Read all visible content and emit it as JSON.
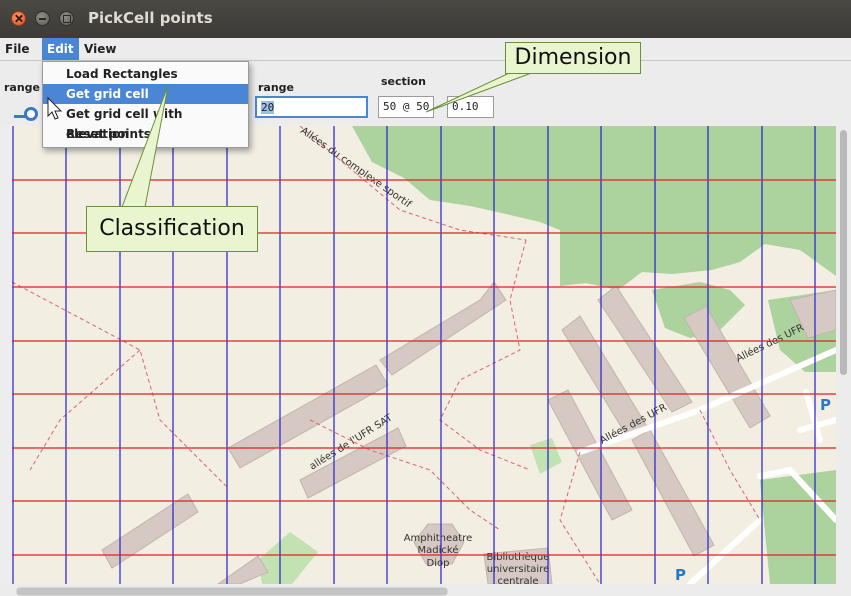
{
  "window": {
    "title": "PickCell points"
  },
  "menubar": {
    "file": "File",
    "edit": "Edit",
    "view": "View"
  },
  "edit_menu": {
    "items": [
      "Load Rectangles",
      "Get grid cell",
      "Get grid cell with elevation",
      "Reset points"
    ],
    "highlighted_index": 1
  },
  "toolbar": {
    "range_left_label": "range",
    "range_label": "range",
    "range_value": "20",
    "section_label": "section",
    "section_value": "50 @ 50",
    "section_value2": "0.10"
  },
  "annotations": {
    "dimension": "Dimension",
    "classification": "Classification"
  },
  "map": {
    "streets": [
      "Allées du complexe sportif",
      "allées de l'UFR SAT",
      "Allées des UFR",
      "Allées des UFR"
    ],
    "pois": [
      "Amphitheatre",
      "Madické",
      "Diop",
      "Bibliothèque",
      "universitaire",
      "centrale"
    ],
    "parking": [
      "P",
      "P"
    ]
  },
  "colors": {
    "grid_vertical": "#2222cc",
    "grid_horizontal": "#dd2222",
    "map_background": "#f2eee2",
    "forest": "#acd29d",
    "building": "#d6c9c3",
    "menu_highlight": "#4a86d4",
    "callout_fill": "#e9f5cf"
  }
}
